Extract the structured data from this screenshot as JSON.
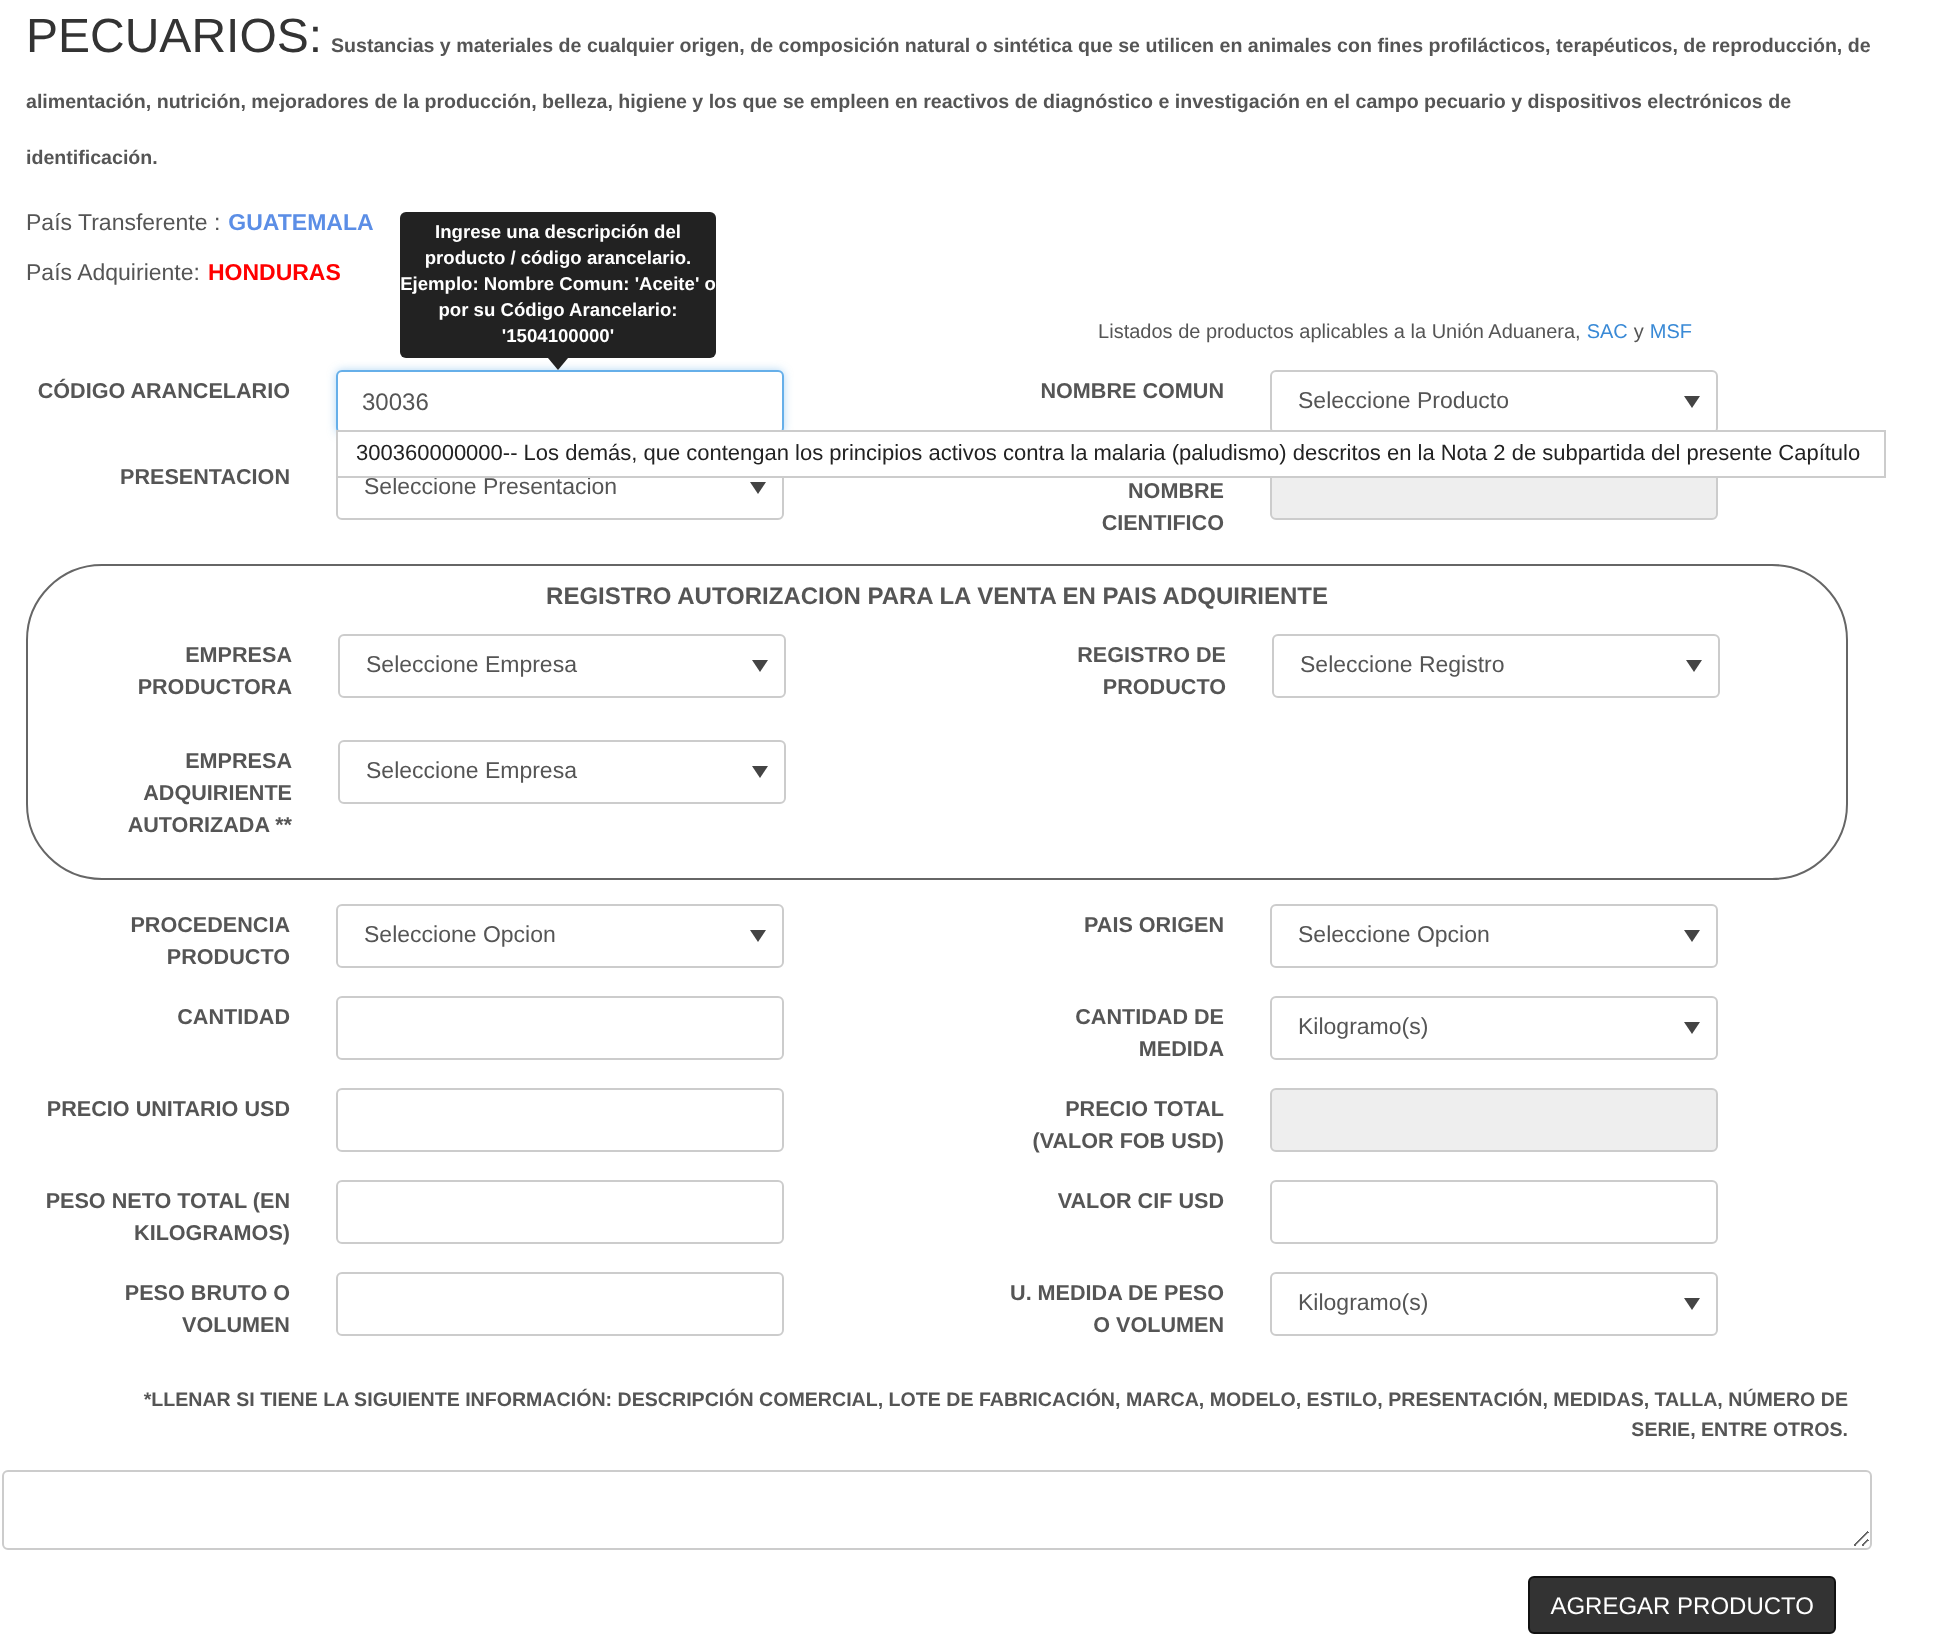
{
  "heading": {
    "title": "PECUARIOS:",
    "description": "Sustancias y materiales de cualquier origen, de composición natural o sintética que se utilicen en animales con fines profilácticos, terapéuticos, de reproducción, de alimentación, nutrición, mejoradores de la producción, belleza, higiene y los que se empleen en reactivos de diagnóstico e investigación en el campo pecuario y dispositivos electrónicos de identificación."
  },
  "countries": [
    {
      "label": "País Transferente :",
      "value": "GUATEMALA",
      "color": "#5b8ee6"
    },
    {
      "label": "País Adquiriente:",
      "value": "HONDURAS",
      "color": "#ff0000"
    }
  ],
  "catalog_note": {
    "text": "Listados de productos aplicables a la Unión Aduanera,",
    "links": [
      "SAC",
      "MSF"
    ],
    "conjunction": "y"
  },
  "sections": [
    {
      "kind": "plain",
      "rows": [
        {
          "left": {
            "label": "CÓDIGO ARANCELARIO",
            "kind": "text",
            "value": "30036",
            "focused": true,
            "tooltip": "Ingrese una descripción del producto / código arancelario. Ejemplo: Nombre Comun: 'Aceite' o por su Código Arancelario: '1504100000'",
            "suggestions": [
              "300360000000-- Los demás, que contengan los principios activos contra la malaria (paludismo) descritos en la Nota 2 de subpartida del presente Capítulo"
            ]
          },
          "right": {
            "label": "NOMBRE COMUN",
            "kind": "select",
            "placeholder": "Seleccione Producto"
          }
        },
        {
          "left": {
            "label": "PRESENTACION",
            "kind": "select",
            "placeholder": "Seleccione Presentacion"
          },
          "right": {
            "label": "NOMBRE CIENTIFICO",
            "kind": "readonly"
          }
        }
      ]
    },
    {
      "kind": "boxed",
      "title": "REGISTRO AUTORIZACION PARA LA VENTA EN PAIS ADQUIRIENTE",
      "rows": [
        {
          "left": {
            "label": "EMPRESA PRODUCTORA",
            "kind": "select",
            "placeholder": "Seleccione Empresa"
          },
          "right": {
            "label": "REGISTRO DE PRODUCTO",
            "kind": "select",
            "placeholder": "Seleccione Registro"
          }
        },
        {
          "left": {
            "label": "EMPRESA ADQUIRIENTE AUTORIZADA **",
            "kind": "select",
            "placeholder": "Seleccione Empresa"
          }
        }
      ]
    },
    {
      "kind": "plain",
      "rows": [
        {
          "left": {
            "label": "PROCEDENCIA PRODUCTO",
            "kind": "select",
            "placeholder": "Seleccione Opcion"
          },
          "right": {
            "label": "PAIS ORIGEN",
            "kind": "select",
            "placeholder": "Seleccione Opcion"
          }
        },
        {
          "left": {
            "label": "CANTIDAD",
            "kind": "text"
          },
          "right": {
            "label": "CANTIDAD DE MEDIDA",
            "kind": "select",
            "value": "Kilogramo(s)"
          }
        },
        {
          "left": {
            "label": "PRECIO UNITARIO USD",
            "kind": "text"
          },
          "right": {
            "label": "PRECIO TOTAL (VALOR FOB USD)",
            "kind": "readonly"
          }
        },
        {
          "left": {
            "label": "PESO NETO TOTAL (EN KILOGRAMOS)",
            "kind": "text"
          },
          "right": {
            "label": "VALOR CIF USD",
            "kind": "text"
          }
        },
        {
          "left": {
            "label": "PESO BRUTO O VOLUMEN",
            "kind": "text"
          },
          "right": {
            "label": "U. MEDIDA DE PESO O VOLUMEN",
            "kind": "select",
            "value": "Kilogramo(s)"
          }
        }
      ]
    }
  ],
  "instructions": "*LLENAR SI TIENE LA SIGUIENTE INFORMACIÓN: DESCRIPCIÓN COMERCIAL, LOTE DE FABRICACIÓN, MARCA, MODELO, ESTILO, PRESENTACIÓN, MEDIDAS, TALLA, NÚMERO DE SERIE, ENTRE OTROS.",
  "submit_button": "AGREGAR PRODUCTO"
}
